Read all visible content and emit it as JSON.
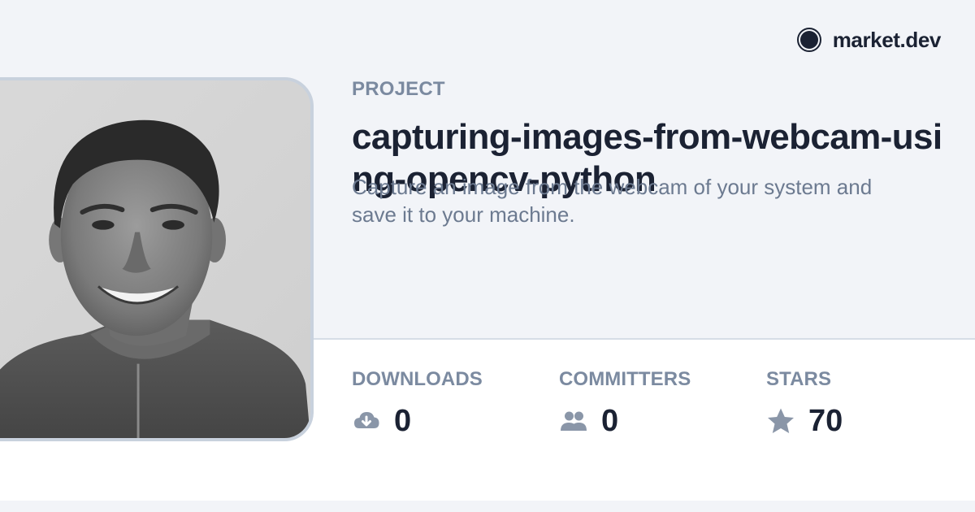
{
  "brand": {
    "name": "market.dev"
  },
  "project": {
    "eyebrow": "PROJECT",
    "title": "capturing-images-from-webcam-using-opencv-python",
    "description": "Capture an image from the webcam of your system and save it to your machine."
  },
  "stats": [
    {
      "label": "DOWNLOADS",
      "value": "0",
      "icon": "cloud-download-icon"
    },
    {
      "label": "COMMITTERS",
      "value": "0",
      "icon": "users-icon"
    },
    {
      "label": "STARS",
      "value": "70",
      "icon": "star-icon"
    }
  ],
  "colors": {
    "background": "#f2f4f8",
    "panel": "#ffffff",
    "text": "#1b2233",
    "muted": "#7b8aa0",
    "iconGray": "#8a96a8"
  }
}
